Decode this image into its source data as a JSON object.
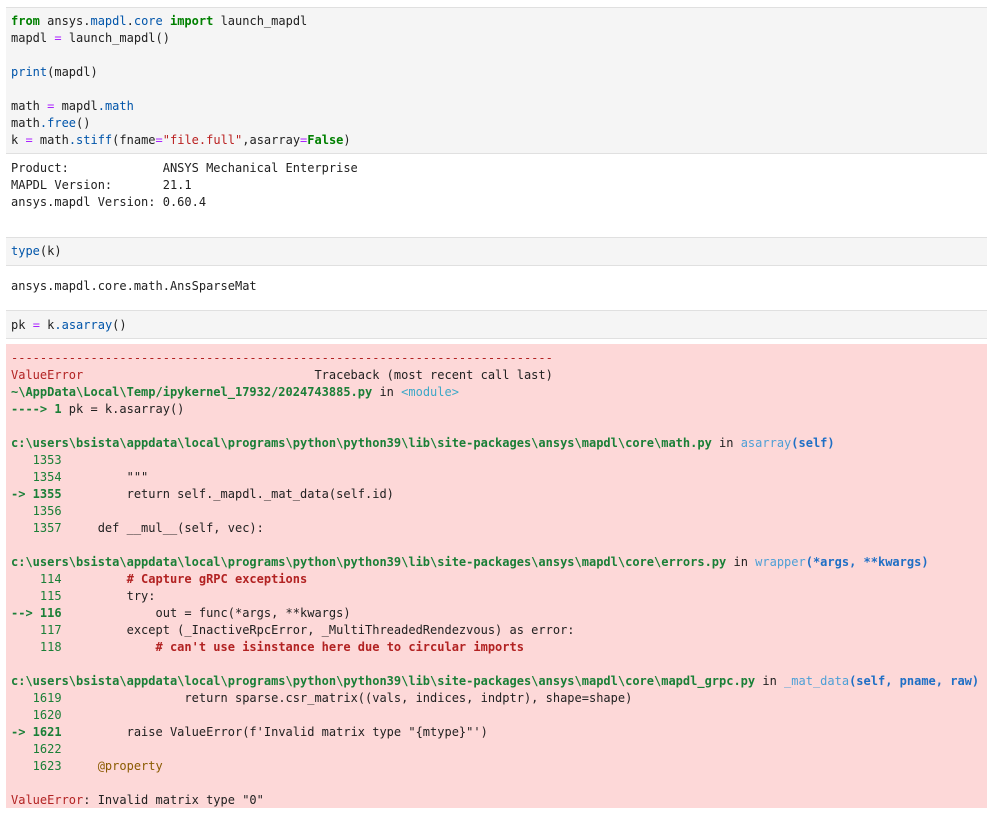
{
  "cell1": {
    "lines": [
      [
        {
          "t": "from",
          "c": "kw"
        },
        {
          "t": " ansys."
        },
        {
          "t": "mapdl",
          "c": "mod"
        },
        {
          "t": "."
        },
        {
          "t": "core",
          "c": "mod"
        },
        {
          "t": " "
        },
        {
          "t": "import",
          "c": "kw"
        },
        {
          "t": " launch_mapdl"
        }
      ],
      [
        {
          "t": "mapdl "
        },
        {
          "t": "=",
          "c": "op"
        },
        {
          "t": " launch_mapdl()"
        }
      ],
      [
        {
          "t": ""
        }
      ],
      [
        {
          "t": "print",
          "c": "fn"
        },
        {
          "t": "(mapdl)"
        }
      ],
      [
        {
          "t": ""
        }
      ],
      [
        {
          "t": "math "
        },
        {
          "t": "=",
          "c": "op"
        },
        {
          "t": " mapdl"
        },
        {
          "t": ".math",
          "c": "attr"
        }
      ],
      [
        {
          "t": "math"
        },
        {
          "t": ".free",
          "c": "attr"
        },
        {
          "t": "()"
        }
      ],
      [
        {
          "t": "k "
        },
        {
          "t": "=",
          "c": "op"
        },
        {
          "t": " math"
        },
        {
          "t": ".stiff",
          "c": "attr"
        },
        {
          "t": "(fname"
        },
        {
          "t": "=",
          "c": "op"
        },
        {
          "t": "\"file.full\"",
          "c": "str"
        },
        {
          "t": ",asarray"
        },
        {
          "t": "=",
          "c": "op"
        },
        {
          "t": "False",
          "c": "false"
        },
        {
          "t": ")"
        }
      ]
    ]
  },
  "out1": {
    "lines": [
      [
        {
          "t": "Product:             ANSYS Mechanical Enterprise"
        }
      ],
      [
        {
          "t": "MAPDL Version:       21.1"
        }
      ],
      [
        {
          "t": "ansys.mapdl Version: 0.60.4"
        }
      ]
    ]
  },
  "cell2": {
    "lines": [
      [
        {
          "t": "type",
          "c": "fn"
        },
        {
          "t": "(k)"
        }
      ]
    ]
  },
  "out2": {
    "lines": [
      [
        {
          "t": "ansys.mapdl.core.math.AnsSparseMat"
        }
      ]
    ]
  },
  "cell3": {
    "lines": [
      [
        {
          "t": "pk "
        },
        {
          "t": "=",
          "c": "op"
        },
        {
          "t": " k"
        },
        {
          "t": ".asarray",
          "c": "attr"
        },
        {
          "t": "()"
        }
      ]
    ]
  },
  "traceback": {
    "lines": [
      [
        {
          "t": "---------------------------------------------------------------------------",
          "c": "red"
        }
      ],
      [
        {
          "t": "ValueError",
          "c": "red"
        },
        {
          "t": "                                Traceback (most recent call last)"
        }
      ],
      [
        {
          "t": "~\\AppData\\Local\\Temp/ipykernel_17932/2024743885.py",
          "c": "grn"
        },
        {
          "t": " in "
        },
        {
          "t": "<module>",
          "c": "cyan"
        }
      ],
      [
        {
          "t": "----> 1",
          "c": "grn"
        },
        {
          "t": " pk = k.asarray()"
        }
      ],
      [
        {
          "t": ""
        }
      ],
      [
        {
          "t": "c:\\users\\bsista\\appdata\\local\\programs\\python\\python39\\lib\\site-packages\\ansys\\mapdl\\core\\math.py",
          "c": "grn"
        },
        {
          "t": " in "
        },
        {
          "t": "asarray",
          "c": "lblue"
        },
        {
          "t": "(self)",
          "c": "blue"
        }
      ],
      [
        {
          "t": "   1353",
          "c": "green"
        }
      ],
      [
        {
          "t": "   1354",
          "c": "green"
        },
        {
          "t": "         \"\"\""
        }
      ],
      [
        {
          "t": "-> 1355",
          "c": "grn"
        },
        {
          "t": "         return self._mapdl._mat_data(self.id)"
        }
      ],
      [
        {
          "t": "   1356",
          "c": "green"
        }
      ],
      [
        {
          "t": "   1357",
          "c": "green"
        },
        {
          "t": "     def __mul__(self, vec):"
        }
      ],
      [
        {
          "t": ""
        }
      ],
      [
        {
          "t": "c:\\users\\bsista\\appdata\\local\\programs\\python\\python39\\lib\\site-packages\\ansys\\mapdl\\core\\errors.py",
          "c": "grn"
        },
        {
          "t": " in "
        },
        {
          "t": "wrapper",
          "c": "lblue"
        },
        {
          "t": "(*args, **kwargs)",
          "c": "blue"
        }
      ],
      [
        {
          "t": "    114",
          "c": "green"
        },
        {
          "t": "         "
        },
        {
          "t": "# Capture gRPC exceptions",
          "c": "com"
        }
      ],
      [
        {
          "t": "    115",
          "c": "green"
        },
        {
          "t": "         try:"
        }
      ],
      [
        {
          "t": "--> 116",
          "c": "grn"
        },
        {
          "t": "             out = func(*args, **kwargs)"
        }
      ],
      [
        {
          "t": "    117",
          "c": "green"
        },
        {
          "t": "         except (_InactiveRpcError, _MultiThreadedRendezvous) as error:"
        }
      ],
      [
        {
          "t": "    118",
          "c": "green"
        },
        {
          "t": "             "
        },
        {
          "t": "# can't use isinstance here due to circular imports",
          "c": "com"
        }
      ],
      [
        {
          "t": ""
        }
      ],
      [
        {
          "t": "c:\\users\\bsista\\appdata\\local\\programs\\python\\python39\\lib\\site-packages\\ansys\\mapdl\\core\\mapdl_grpc.py",
          "c": "grn"
        },
        {
          "t": " in "
        },
        {
          "t": "_mat_data",
          "c": "lblue"
        },
        {
          "t": "(self, pname, raw)",
          "c": "blue"
        }
      ],
      [
        {
          "t": "   1619",
          "c": "green"
        },
        {
          "t": "                 return sparse.csr_matrix((vals, indices, indptr), shape=shape)"
        }
      ],
      [
        {
          "t": "   1620",
          "c": "green"
        }
      ],
      [
        {
          "t": "-> 1621",
          "c": "grn"
        },
        {
          "t": "         raise ValueError(f'Invalid matrix type \"{mtype}\"')"
        }
      ],
      [
        {
          "t": "   1622",
          "c": "green"
        }
      ],
      [
        {
          "t": "   1623",
          "c": "green"
        },
        {
          "t": "     "
        },
        {
          "t": "@property",
          "c": "dec"
        }
      ],
      [
        {
          "t": ""
        }
      ],
      [
        {
          "t": "ValueError",
          "c": "red"
        },
        {
          "t": ": Invalid matrix type \"0\""
        }
      ]
    ]
  }
}
